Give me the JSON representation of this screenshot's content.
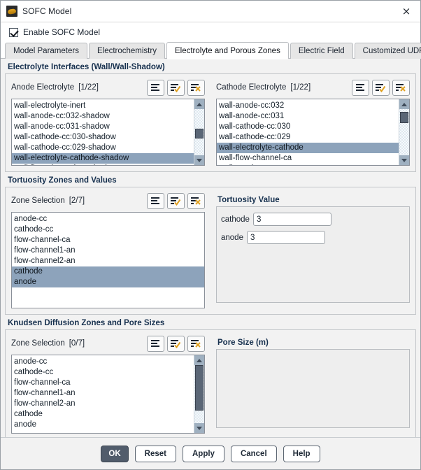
{
  "window": {
    "title": "SOFC Model",
    "app_icon": "sofc-app-icon",
    "close_label": "×"
  },
  "enable": {
    "label": "Enable SOFC Model",
    "checked": true
  },
  "tabs": [
    {
      "label": "Model Parameters",
      "active": false
    },
    {
      "label": "Electrochemistry",
      "active": false
    },
    {
      "label": "Electrolyte and Porous Zones",
      "active": true
    },
    {
      "label": "Electric Field",
      "active": false
    },
    {
      "label": "Customized UDFs",
      "active": false
    }
  ],
  "sections": {
    "electrolyte_interfaces": {
      "title": "Electrolyte Interfaces (Wall/Wall-Shadow)",
      "anode": {
        "label": "Anode Electrolyte",
        "count": "[1/22]",
        "toolbar": [
          "list-icon",
          "select-all-icon",
          "deselect-all-icon"
        ],
        "items": [
          {
            "text": "wall-electrolyte-inert",
            "selected": false
          },
          {
            "text": "wall-anode-cc:032-shadow",
            "selected": false
          },
          {
            "text": "wall-anode-cc:031-shadow",
            "selected": false
          },
          {
            "text": "wall-cathode-cc:030-shadow",
            "selected": false
          },
          {
            "text": "wall-cathode-cc:029-shadow",
            "selected": false
          },
          {
            "text": "wall-electrolyte-cathode-shadow",
            "selected": true
          },
          {
            "text": "wall-flow-channel-ca-shadow",
            "selected": false
          }
        ],
        "scroll": {
          "thumb_top_pct": 43,
          "thumb_height_pct": 20
        }
      },
      "cathode": {
        "label": "Cathode Electrolyte",
        "count": "[1/22]",
        "toolbar": [
          "list-icon",
          "select-all-icon",
          "deselect-all-icon"
        ],
        "items": [
          {
            "text": "wall-anode-cc:032",
            "selected": false
          },
          {
            "text": "wall-anode-cc:031",
            "selected": false
          },
          {
            "text": "wall-cathode-cc:030",
            "selected": false
          },
          {
            "text": "wall-cathode-cc:029",
            "selected": false
          },
          {
            "text": "wall-electrolyte-cathode",
            "selected": true
          },
          {
            "text": "wall-flow-channel-ca",
            "selected": false
          },
          {
            "text": "wall-anode-cc",
            "selected": false
          }
        ],
        "scroll": {
          "thumb_top_pct": 8,
          "thumb_height_pct": 22
        }
      }
    },
    "tortuosity": {
      "title": "Tortuosity Zones and Values",
      "zones": {
        "label": "Zone Selection",
        "count": "[2/7]",
        "toolbar": [
          "list-icon",
          "select-all-icon",
          "deselect-all-icon"
        ],
        "items": [
          {
            "text": "anode-cc",
            "selected": false
          },
          {
            "text": "cathode-cc",
            "selected": false
          },
          {
            "text": "flow-channel-ca",
            "selected": false
          },
          {
            "text": "flow-channel1-an",
            "selected": false
          },
          {
            "text": "flow-channel2-an",
            "selected": false
          },
          {
            "text": "cathode",
            "selected": true
          },
          {
            "text": "anode",
            "selected": true
          }
        ]
      },
      "values": {
        "title": "Tortuosity Value",
        "fields": [
          {
            "label": "cathode",
            "value": "3"
          },
          {
            "label": "anode",
            "value": "3"
          }
        ]
      }
    },
    "knudsen": {
      "title": "Knudsen Diffusion Zones and Pore Sizes",
      "zones": {
        "label": "Zone Selection",
        "count": "[0/7]",
        "toolbar": [
          "list-icon",
          "select-all-icon",
          "deselect-all-icon"
        ],
        "items": [
          {
            "text": "anode-cc",
            "selected": false
          },
          {
            "text": "cathode-cc",
            "selected": false
          },
          {
            "text": "flow-channel-ca",
            "selected": false
          },
          {
            "text": "flow-channel1-an",
            "selected": false
          },
          {
            "text": "flow-channel2-an",
            "selected": false
          },
          {
            "text": "cathode",
            "selected": false
          },
          {
            "text": "anode",
            "selected": false
          }
        ],
        "scroll": {
          "thumb_top_pct": 0,
          "thumb_height_pct": 78
        }
      },
      "pore_size": {
        "title": "Pore Size (m)",
        "fields": []
      }
    }
  },
  "footer": {
    "buttons": [
      {
        "label": "OK",
        "primary": true
      },
      {
        "label": "Reset",
        "primary": false
      },
      {
        "label": "Apply",
        "primary": false
      },
      {
        "label": "Cancel",
        "primary": false
      },
      {
        "label": "Help",
        "primary": false
      }
    ]
  },
  "colors": {
    "selection": "#8da3bb",
    "section_title": "#16304e",
    "primary_button": "#515c6b",
    "icon_accent": "#e0a020"
  }
}
